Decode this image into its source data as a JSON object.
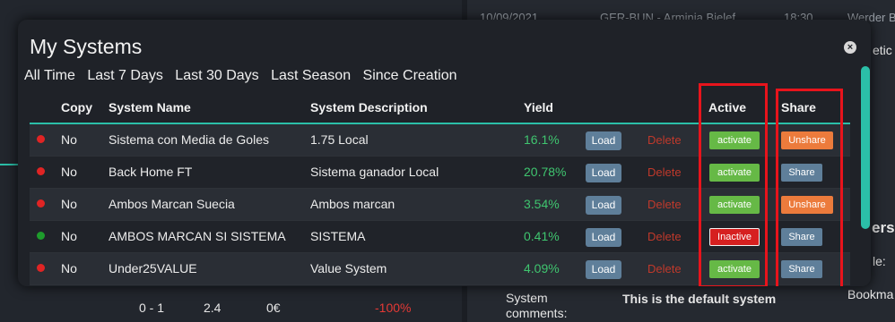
{
  "background": {
    "top_row": [
      "10/09/2021",
      "GER-BUN - Arminia Bielef",
      "18:30",
      "Werder B"
    ],
    "right_snippets": [
      "etic",
      "ers",
      "le:",
      "Bookma"
    ],
    "bottom_stats": [
      "0 - 1",
      "2.4",
      "0€",
      "-100%"
    ],
    "system_comments_label": "System comments:",
    "default_system_text": "This is the default system"
  },
  "modal": {
    "title": "My Systems",
    "close_icon": "×",
    "filters": [
      "All Time",
      "Last 7 Days",
      "Last 30 Days",
      "Last Season",
      "Since Creation"
    ],
    "columns": {
      "copy": "Copy",
      "name": "System Name",
      "description": "System Description",
      "yield": "Yield",
      "active": "Active",
      "share": "Share"
    },
    "load_label": "Load",
    "delete_label": "Delete",
    "rows": [
      {
        "status": "red",
        "copy": "No",
        "name": "Sistema con Media de Goles",
        "description": "1.75 Local",
        "yield": "16.1%",
        "active": "activate",
        "active_state": "activate",
        "share": "Unshare",
        "share_state": "unshare"
      },
      {
        "status": "red",
        "copy": "No",
        "name": "Back Home FT",
        "description": "Sistema ganador Local",
        "yield": "20.78%",
        "active": "activate",
        "active_state": "activate",
        "share": "Share",
        "share_state": "share"
      },
      {
        "status": "red",
        "copy": "No",
        "name": "Ambos Marcan Suecia",
        "description": "Ambos marcan",
        "yield": "3.54%",
        "active": "activate",
        "active_state": "activate",
        "share": "Unshare",
        "share_state": "unshare"
      },
      {
        "status": "green",
        "copy": "No",
        "name": "AMBOS MARCAN SI SISTEMA",
        "description": "SISTEMA",
        "yield": "0.41%",
        "active": "Inactive",
        "active_state": "inactive",
        "share": "Share",
        "share_state": "share"
      },
      {
        "status": "red",
        "copy": "No",
        "name": "Under25VALUE",
        "description": "Value System",
        "yield": "4.09%",
        "active": "activate",
        "active_state": "activate",
        "share": "Share",
        "share_state": "share"
      }
    ]
  },
  "colors": {
    "accent": "#2bbfa8",
    "yield_green": "#3fc56f",
    "delete_red": "#c0392b",
    "highlight_red": "#e8141c",
    "activate_green": "#66b946",
    "inactive_red": "#d62020",
    "share_blue": "#5f7f9a",
    "unshare_orange": "#ec7b3c"
  }
}
